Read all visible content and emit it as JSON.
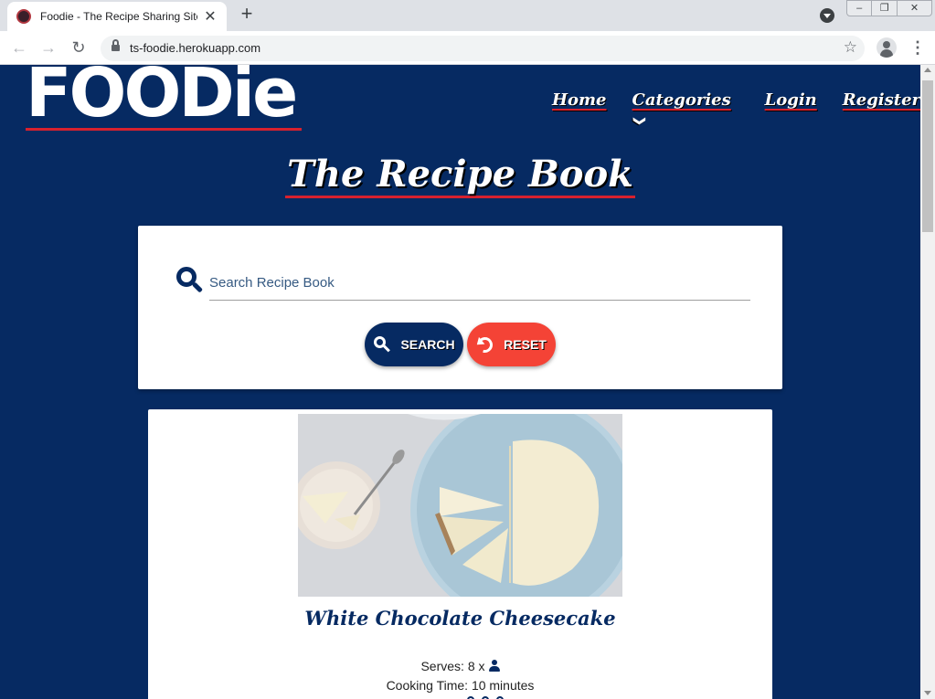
{
  "browser": {
    "tab_title": "Foodie - The Recipe Sharing Site",
    "tab_close": "✕",
    "new_tab": "+",
    "url": "ts-foodie.herokuapp.com",
    "window_controls": {
      "minimize": "–",
      "restore": "❐",
      "close": "✕"
    }
  },
  "site": {
    "logo_text": "FOODie",
    "nav": {
      "home": "Home",
      "categories": "Categories",
      "login": "Login",
      "register": "Register"
    },
    "page_title": "The Recipe Book"
  },
  "search": {
    "placeholder": "Search Recipe Book",
    "search_label": "SEARCH",
    "reset_label": "RESET"
  },
  "recipe": {
    "title": "White Chocolate Cheesecake",
    "serves_label": "Serves:",
    "serves_value": "8 x",
    "time_label": "Cooking Time:",
    "time_value": "10 minutes"
  },
  "colors": {
    "navy": "#062a62",
    "accent_red": "#d7212e",
    "reset_red": "#f44336"
  },
  "icons": {
    "search": "magnifier",
    "reset": "undo",
    "dropdown": "chevron-down",
    "serves": "person"
  }
}
